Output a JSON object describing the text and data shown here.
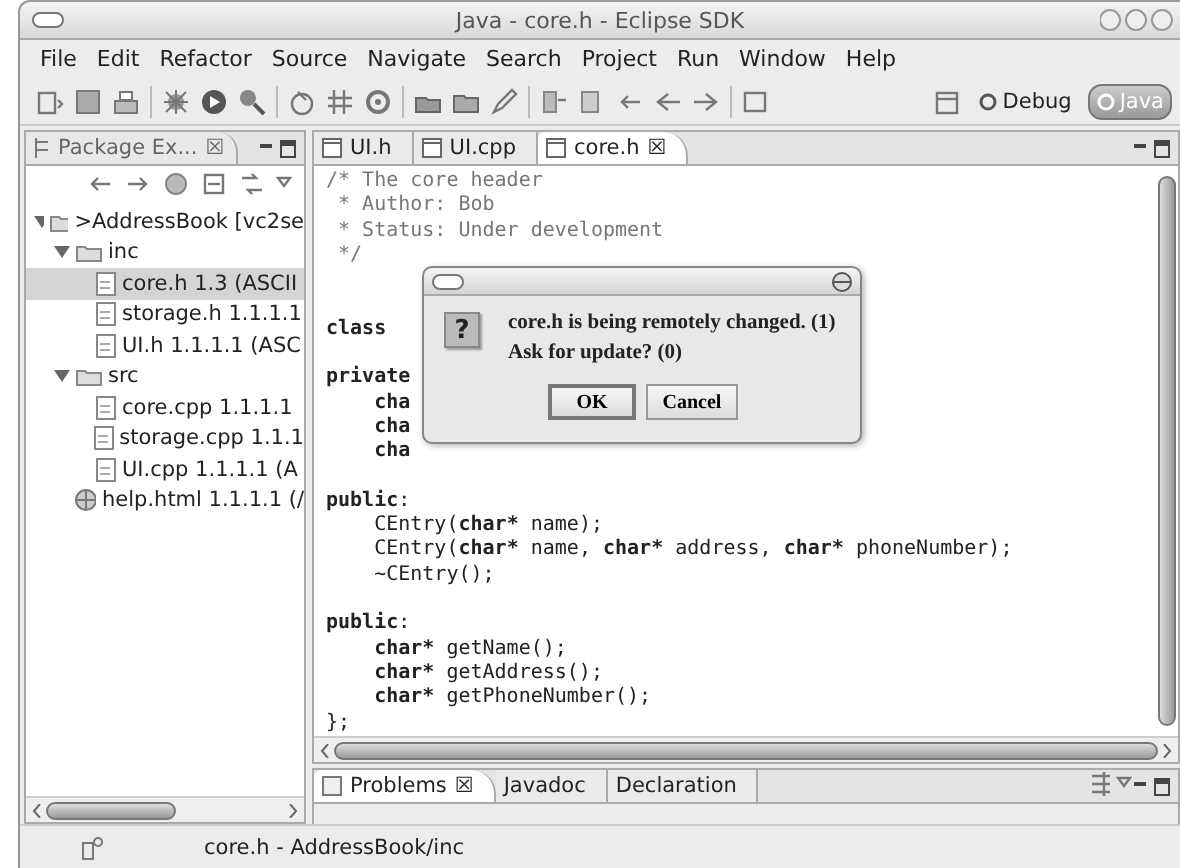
{
  "window": {
    "title": "Java - core.h - Eclipse SDK"
  },
  "menu": [
    "File",
    "Edit",
    "Refactor",
    "Source",
    "Navigate",
    "Search",
    "Project",
    "Run",
    "Window",
    "Help"
  ],
  "perspectives": [
    {
      "label": "Debug",
      "selected": false
    },
    {
      "label": "Java",
      "selected": true
    }
  ],
  "explorer": {
    "tab": {
      "label": "Package Ex...",
      "close": "☒"
    },
    "tree": [
      {
        "label": ">AddressBook  [vc2se",
        "kind": "project",
        "expanded": true,
        "selected": false,
        "children": [
          {
            "label": "inc",
            "kind": "folder",
            "expanded": true,
            "selected": false,
            "children": [
              {
                "label": "core.h  1.3  (ASCII",
                "kind": "file",
                "selected": true
              },
              {
                "label": "storage.h  1.1.1.1",
                "kind": "file",
                "selected": false
              },
              {
                "label": "UI.h  1.1.1.1  (ASC",
                "kind": "file",
                "selected": false
              }
            ]
          },
          {
            "label": "src",
            "kind": "folder",
            "expanded": true,
            "selected": false,
            "children": [
              {
                "label": "core.cpp  1.1.1.1",
                "kind": "file",
                "selected": false
              },
              {
                "label": "storage.cpp  1.1.1",
                "kind": "file",
                "selected": false
              },
              {
                "label": "UI.cpp  1.1.1.1  (A",
                "kind": "file",
                "selected": false
              }
            ]
          },
          {
            "label": "help.html  1.1.1.1  (/",
            "kind": "web",
            "selected": false
          }
        ]
      }
    ]
  },
  "editor": {
    "tabs": [
      {
        "label": "UI.h",
        "selected": false
      },
      {
        "label": "UI.cpp",
        "selected": false
      },
      {
        "label": "core.h",
        "selected": true,
        "close": "☒"
      }
    ],
    "blocks": [
      [
        [
          {
            "text": "/* The core header",
            "kind": "comment"
          }
        ],
        [
          {
            "text": " * Author: Bob",
            "kind": "comment"
          }
        ],
        [
          {
            "text": " * Status: Under development",
            "kind": "comment"
          }
        ],
        [
          {
            "text": " */",
            "kind": "comment"
          }
        ]
      ],
      [
        [
          {
            "text": "class",
            "kind": "keyword"
          }
        ]
      ],
      [
        [
          {
            "text": "private",
            "kind": "keyword"
          }
        ],
        [
          {
            "text": "    cha",
            "kind": "keyword"
          }
        ],
        [
          {
            "text": "    cha",
            "kind": "keyword"
          }
        ],
        [
          {
            "text": "    cha",
            "kind": "keyword"
          }
        ]
      ],
      [
        [
          {
            "text": "public",
            "kind": "keyword"
          },
          {
            "text": ":",
            "kind": "plain"
          }
        ],
        [
          {
            "text": "    CEntry(",
            "kind": "plain"
          },
          {
            "text": "char*",
            "kind": "keyword"
          },
          {
            "text": " name);",
            "kind": "plain"
          }
        ],
        [
          {
            "text": "    CEntry(",
            "kind": "plain"
          },
          {
            "text": "char*",
            "kind": "keyword"
          },
          {
            "text": " name, ",
            "kind": "plain"
          },
          {
            "text": "char*",
            "kind": "keyword"
          },
          {
            "text": " address, ",
            "kind": "plain"
          },
          {
            "text": "char*",
            "kind": "keyword"
          },
          {
            "text": " phoneNumber);",
            "kind": "plain"
          }
        ],
        [
          {
            "text": "    ~CEntry();",
            "kind": "plain"
          }
        ]
      ],
      [
        [
          {
            "text": "public",
            "kind": "keyword"
          },
          {
            "text": ":",
            "kind": "plain"
          }
        ],
        [
          {
            "text": "    char*",
            "kind": "keyword"
          },
          {
            "text": " getName();",
            "kind": "plain"
          }
        ],
        [
          {
            "text": "    char*",
            "kind": "keyword"
          },
          {
            "text": " getAddress();",
            "kind": "plain"
          }
        ],
        [
          {
            "text": "    char*",
            "kind": "keyword"
          },
          {
            "text": " getPhoneNumber();",
            "kind": "plain"
          }
        ],
        [
          {
            "text": "};",
            "kind": "plain"
          }
        ]
      ]
    ]
  },
  "dialog": {
    "icon": "?",
    "message": "core.h is being remotely changed. (1)",
    "question": "Ask for update? (0)",
    "buttons": [
      {
        "label": "OK",
        "selected": true
      },
      {
        "label": "Cancel",
        "selected": false
      }
    ]
  },
  "bottom_tabs": [
    {
      "label": "Problems",
      "selected": true,
      "close": "☒"
    },
    {
      "label": "Javadoc",
      "selected": false
    },
    {
      "label": "Declaration",
      "selected": false
    }
  ],
  "status_bar": {
    "text": "core.h - AddressBook/inc"
  }
}
